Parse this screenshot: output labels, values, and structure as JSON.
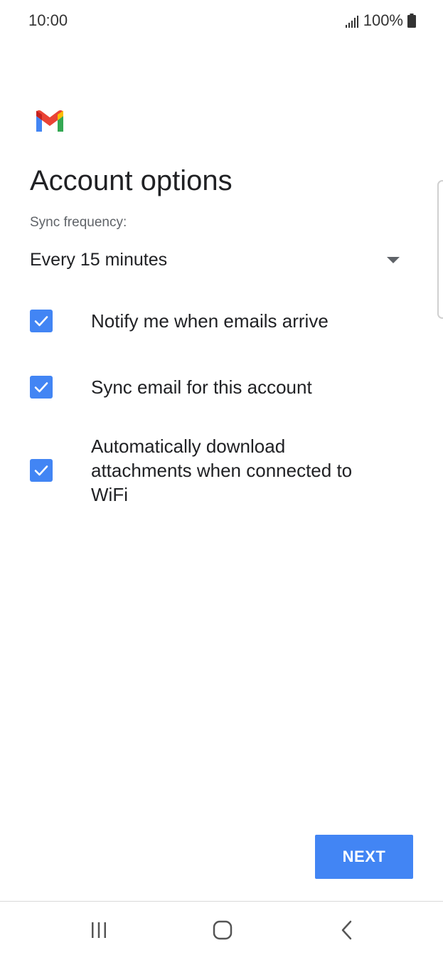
{
  "status_bar": {
    "time": "10:00",
    "battery": "100%",
    "icons": [
      "signal-icon",
      "battery-icon"
    ]
  },
  "logo": {
    "icon": "gmail-logo",
    "colors": [
      "#4285f4",
      "#ea4335",
      "#fbbc04",
      "#34a853",
      "#c5221f"
    ]
  },
  "page": {
    "title": "Account options"
  },
  "sync": {
    "label": "Sync frequency:",
    "value": "Every 15 minutes",
    "icon": "dropdown-arrow-icon"
  },
  "options": [
    {
      "label": "Notify me when emails arrive",
      "checked": true
    },
    {
      "label": "Sync email for this account",
      "checked": true
    },
    {
      "label": "Automatically download attachments when connected to WiFi",
      "checked": true
    }
  ],
  "actions": {
    "next_label": "NEXT"
  },
  "nav_bar": {
    "icons": [
      "recent-apps-icon",
      "home-icon",
      "back-icon"
    ]
  },
  "colors": {
    "accent": "#4285f4",
    "text": "#202124",
    "secondary_text": "#5f6368"
  }
}
